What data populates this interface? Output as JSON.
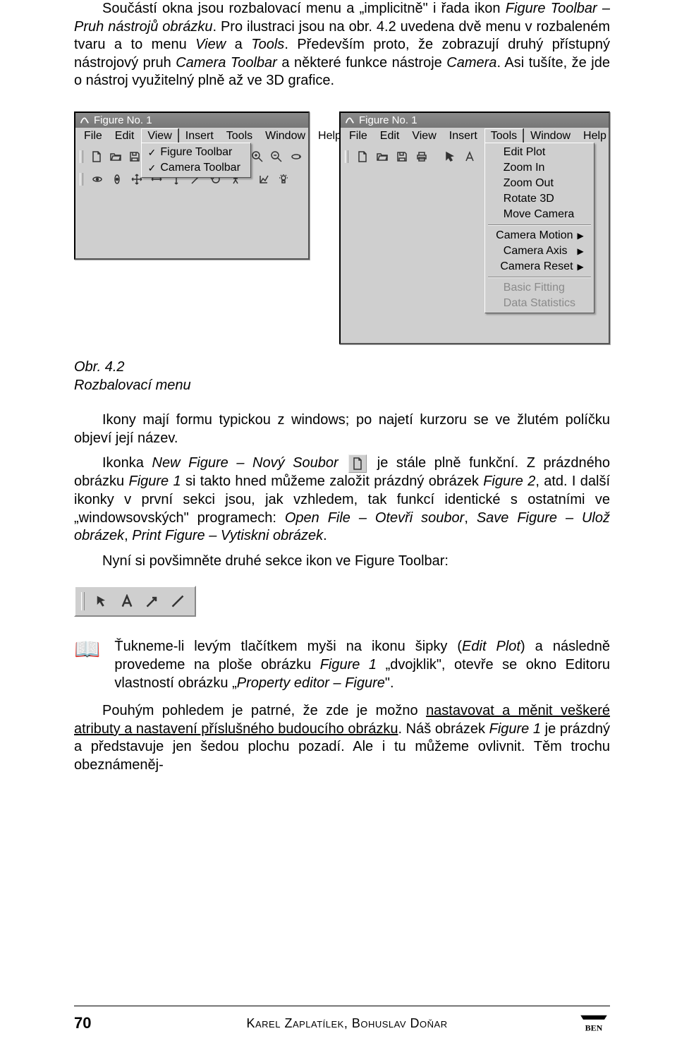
{
  "para1_pre": "Součástí okna jsou rozbalovací menu a „implicitně\" i řada ikon ",
  "para1_i1": "Figure Toolbar – Pruh nástrojů obrázku",
  "para1_mid1": ". Pro ilustraci jsou na obr. 4.2 uvedena dvě menu v rozbaleném tvaru a to menu ",
  "para1_i2": "View",
  "para1_mid2": " a ",
  "para1_i3": "Tools",
  "para1_mid3": ". Především proto, že zobrazují druhý přístupný nástrojový pruh ",
  "para1_i4": "Camera Toolbar",
  "para1_mid4": " a některé funkce nástroje ",
  "para1_i5": "Camera",
  "para1_end": ". Asi tušíte, že jde o nástroj využitelný plně až ve 3D grafice.",
  "win_title": "Figure No. 1",
  "menubar": {
    "file": "File",
    "edit": "Edit",
    "view": "View",
    "insert": "Insert",
    "tools": "Tools",
    "window": "Window",
    "help": "Help"
  },
  "view_menu": {
    "item1": "Figure Toolbar",
    "item2": "Camera Toolbar"
  },
  "tools_menu": {
    "edit_plot": "Edit Plot",
    "zoom_in": "Zoom In",
    "zoom_out": "Zoom Out",
    "rotate_3d": "Rotate 3D",
    "move_camera": "Move Camera",
    "camera_motion": "Camera Motion",
    "camera_axis": "Camera Axis",
    "camera_reset": "Camera Reset",
    "basic_fitting": "Basic Fitting",
    "data_stats": "Data Statistics"
  },
  "caption_label": "Obr. 4.2",
  "caption_text": "Rozbalovací menu",
  "para2": "Ikony mají formu typickou z windows; po najetí kurzoru se ve žlutém políčku objeví její název.",
  "p3_a": "Ikonka ",
  "p3_i1": "New Figure – Nový Soubor",
  "p3_b": " je stále plně funkční. Z prázdného obrázku ",
  "p3_i2": "Figure 1",
  "p3_c": " si takto hned můžeme založit prázdný obrázek ",
  "p3_i3": "Figure 2",
  "p3_d": ", atd. I další ikonky v první sekci jsou, jak vzhledem, tak funkcí identické s ostatními ve „windowsovských\" programech: ",
  "p3_i4": "Open File – Otevři soubor",
  "p3_e": ", ",
  "p3_i5": "Save Figure – Ulož obrázek",
  "p3_f": ", ",
  "p3_i6": "Print Figure – Vytiskni obrázek",
  "p3_g": ".",
  "para4": "Nyní si povšimněte druhé sekce ikon ve Figure Toolbar:",
  "note_a": "Ťukneme-li levým tlačítkem myši na ikonu šipky (",
  "note_i1": "Edit Plot",
  "note_b": ") a následně provedeme na ploše obrázku ",
  "note_i2": "Figure 1",
  "note_c": " „dvojklik\", otevře se okno Editoru vlastností obrázku „",
  "note_i3": "Property editor – Figure",
  "note_d": "\".",
  "p5_a": "Pouhým pohledem je patrné, že zde je možno ",
  "p5_u": "nastavovat a měnit veškeré atributy a nastavení příslušného budoucího obrázku",
  "p5_b": ". Náš obrázek ",
  "p5_i1": "Figure 1",
  "p5_c": " je prázdný a představuje jen šedou plochu pozadí. Ale i tu můžeme ovlivnit. Těm trochu obeznámeněj-",
  "footer": {
    "page": "70",
    "authors": "Karel Zaplatílek, Bohuslav Doňar",
    "logo": "BEN"
  }
}
